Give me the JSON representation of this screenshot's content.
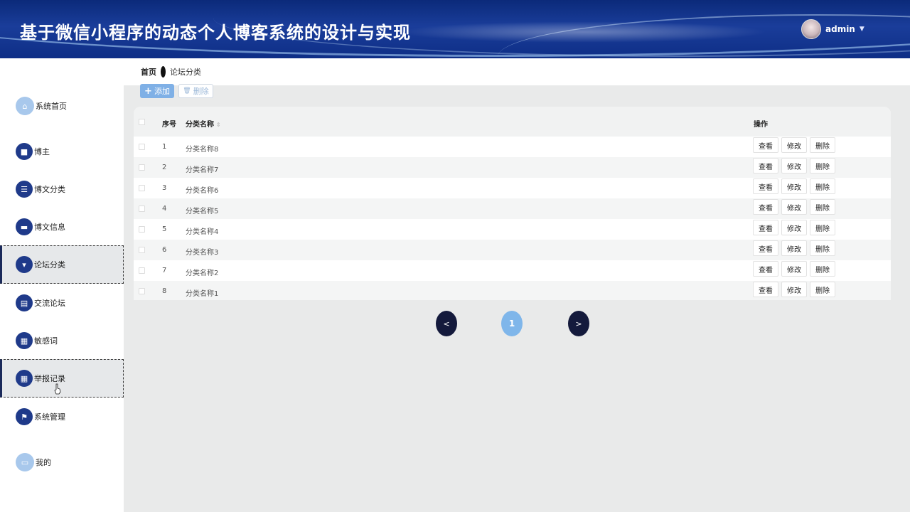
{
  "header": {
    "title": "基于微信小程序的动态个人博客系统的设计与实现",
    "username": "admin",
    "caret": "▼"
  },
  "breadcrumb": {
    "home": "首页",
    "current": "论坛分类"
  },
  "sidebar": {
    "items": [
      {
        "label": "系统首页",
        "icon": "home-icon",
        "glyph": "⌂"
      },
      {
        "label": "博主",
        "icon": "briefcase-icon",
        "glyph": "■"
      },
      {
        "label": "博文分类",
        "icon": "list-icon",
        "glyph": "☰"
      },
      {
        "label": "博文信息",
        "icon": "ticket-icon",
        "glyph": "▬"
      },
      {
        "label": "论坛分类",
        "icon": "signpost-icon",
        "glyph": "▾",
        "active": true
      },
      {
        "label": "交流论坛",
        "icon": "clipboard-icon",
        "glyph": "▤"
      },
      {
        "label": "敏感词",
        "icon": "grid-icon",
        "glyph": "▦"
      },
      {
        "label": "举报记录",
        "icon": "grid-icon",
        "glyph": "▦"
      },
      {
        "label": "系统管理",
        "icon": "flag-icon",
        "glyph": "⚑"
      },
      {
        "label": "我的",
        "icon": "card-icon",
        "glyph": "▭"
      }
    ]
  },
  "toolbar": {
    "add_label": "添加",
    "add_glyph": "+",
    "delete_label": "删除",
    "delete_glyph": "🗑"
  },
  "table": {
    "columns": {
      "index": "序号",
      "name": "分类名称",
      "sort_glyph": "⇕",
      "actions": "操作"
    },
    "rows": [
      {
        "index": "1",
        "name": "分类名称8"
      },
      {
        "index": "2",
        "name": "分类名称7"
      },
      {
        "index": "3",
        "name": "分类名称6"
      },
      {
        "index": "4",
        "name": "分类名称5"
      },
      {
        "index": "5",
        "name": "分类名称4"
      },
      {
        "index": "6",
        "name": "分类名称3"
      },
      {
        "index": "7",
        "name": "分类名称2"
      },
      {
        "index": "8",
        "name": "分类名称1"
      }
    ],
    "actions": {
      "view": "查看",
      "edit": "修改",
      "delete": "删除"
    }
  },
  "pagination": {
    "prev": "<",
    "current_page": "1",
    "next": ">"
  },
  "colors": {
    "header_bg": "#0e2e86",
    "menu_icon": "#1f3a8a",
    "add_button": "#7fb0e6",
    "page_button": "#141a3c",
    "page_current": "#7fb6ea"
  }
}
